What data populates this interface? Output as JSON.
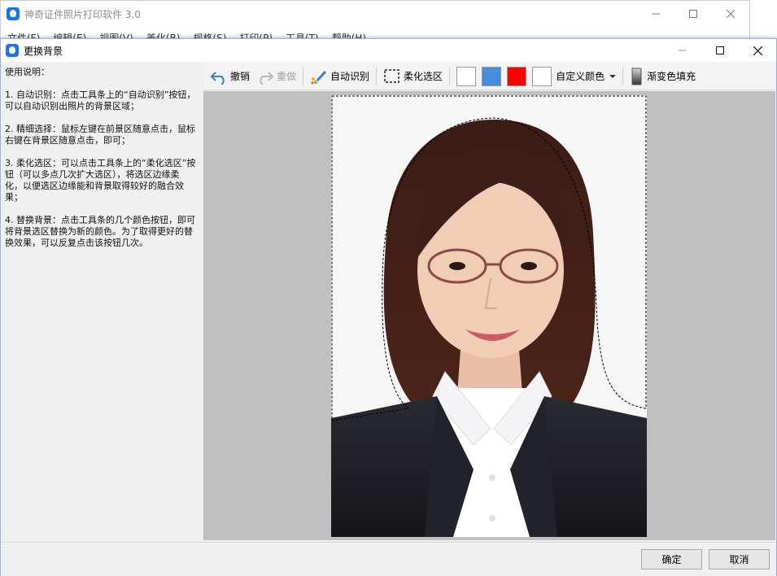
{
  "app": {
    "title": "神奇证件照片打印软件 3.0",
    "menu": [
      "文件(F)",
      "编辑(E)",
      "视图(V)",
      "美化(B)",
      "规格(S)",
      "打印(P)",
      "工具(T)",
      "帮助(H)"
    ]
  },
  "dialog": {
    "title": "更换背景",
    "instructions": {
      "heading": "使用说明：",
      "items": [
        "1. 自动识别：点击工具条上的“自动识别”按钮，可以自动识别出照片的背景区域；",
        "2. 精细选择：鼠标左键在前景区随意点击，鼠标右键在背景区随意点击，即可；",
        "3. 柔化选区：可以点击工具条上的“柔化选区”按钮（可以多点几次扩大选区），将选区边缘柔化，以便选区边缘能和背景取得较好的融合效果；",
        "4. 替换背景：点击工具条的几个颜色按钮，即可将背景选区替换为新的颜色。为了取得更好的替换效果，可以反复点击该按钮几次。"
      ]
    },
    "toolbar": {
      "undo": "撤销",
      "redo": "重做",
      "auto_detect": "自动识别",
      "soften": "柔化选区",
      "custom_color": "自定义颜色",
      "gradient_fill": "渐变色填充"
    },
    "colors": {
      "white_1": "#ffffff",
      "blue": "#438fdd",
      "red": "#ff0000",
      "white_2": "#ffffff"
    },
    "buttons": {
      "ok": "确定",
      "cancel": "取消"
    }
  }
}
